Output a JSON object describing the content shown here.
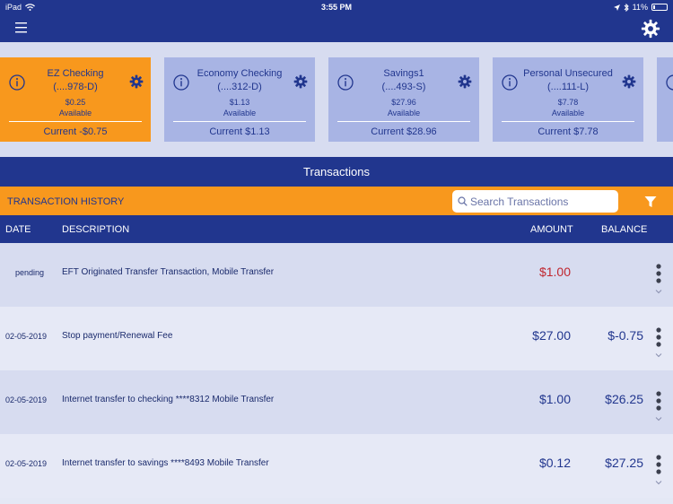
{
  "status_bar": {
    "device": "iPad",
    "time": "3:55 PM",
    "battery": "11%"
  },
  "accounts": [
    {
      "name": "EZ Checking",
      "number": "(....978-D)",
      "available": "$0.25",
      "available_label": "Available",
      "current": "Current -$0.75",
      "active": true
    },
    {
      "name": "Economy Checking",
      "number": "(....312-D)",
      "available": "$1.13",
      "available_label": "Available",
      "current": "Current $1.13",
      "active": false
    },
    {
      "name": "Savings1",
      "number": "(....493-S)",
      "available": "$27.96",
      "available_label": "Available",
      "current": "Current $28.96",
      "active": false
    },
    {
      "name": "Personal Unsecured",
      "number": "(....111-L)",
      "available": "$7.78",
      "available_label": "Available",
      "current": "Current $7.78",
      "active": false
    }
  ],
  "transactions_title": "Transactions",
  "history": {
    "title": "TRANSACTION HISTORY",
    "search_placeholder": "Search Transactions"
  },
  "columns": {
    "date": "DATE",
    "description": "DESCRIPTION",
    "amount": "AMOUNT",
    "balance": "BALANCE"
  },
  "rows": [
    {
      "date": "pending",
      "description": "EFT Originated Transfer Transaction, Mobile Transfer",
      "amount": "$1.00",
      "balance": ""
    },
    {
      "date": "02-05-2019",
      "description": "Stop payment/Renewal Fee",
      "amount": "$27.00",
      "balance": "$-0.75"
    },
    {
      "date": "02-05-2019",
      "description": "Internet transfer to checking ****8312 Mobile Transfer",
      "amount": "$1.00",
      "balance": "$26.25"
    },
    {
      "date": "02-05-2019",
      "description": "Internet transfer to savings ****8493 Mobile Transfer",
      "amount": "$0.12",
      "balance": "$27.25"
    }
  ],
  "colors": {
    "navy": "#21368e",
    "orange": "#f8981d",
    "card_blue": "#a8b4e4",
    "pending_red": "#c0262f"
  }
}
